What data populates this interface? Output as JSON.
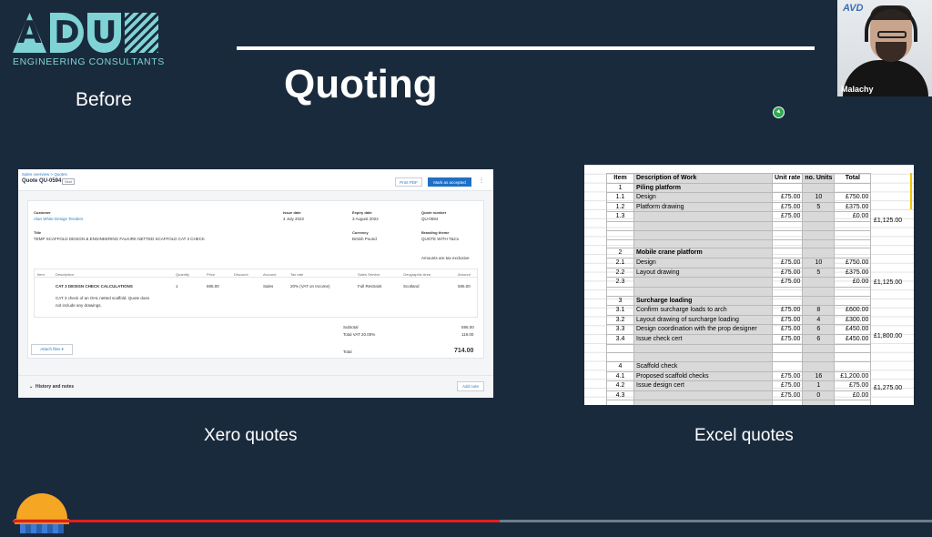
{
  "logo": {
    "letters": [
      "A",
      "D",
      "U",
      "N"
    ],
    "subtitle": "ENGINEERING CONSULTANTS"
  },
  "slide": {
    "title": "Quoting",
    "before_label": "Before",
    "xero_caption": "Xero quotes",
    "excel_caption": "Excel quotes"
  },
  "webcam": {
    "name": "Malachy",
    "logo": "AVD"
  },
  "xero": {
    "breadcrumb": "Sales overview  >  Quotes",
    "quote_id": "Quote QU-0594",
    "badge": "Sent",
    "print_pdf": "Print PDF",
    "mark_accepted": "Mark as accepted",
    "more": "⋮",
    "labels": {
      "customer": "Customer",
      "issue_date": "Issue date",
      "expiry_date": "Expiry date",
      "quote_number": "Quote number",
      "title": "Title",
      "currency": "Currency",
      "branding": "Branding theme"
    },
    "values": {
      "customer": "Alan White Design Tenders",
      "issue_date": "4 July 2022",
      "expiry_date": "3 August 2022",
      "quote_number": "QU-0594",
      "title": "TEMP SCAFFOLD DESIGN & ENGINEERING FALKIRK NETTED SCAFFOLD CAT 3 CHECK",
      "currency": "British Pound",
      "branding": "QUOTE WITH T&Cs"
    },
    "tax_note": "Amounts are tax exclusive",
    "columns": [
      "Item",
      "Description",
      "Quantity",
      "Price",
      "Discount",
      "Account",
      "Tax rate",
      "Sales Service",
      "Geographic Area",
      "Amount"
    ],
    "line": {
      "description": "CAT 3 DESIGN CHECK CALCULATIONS",
      "quantity": "1",
      "price": "595.00",
      "account": "Sales",
      "tax_rate": "20% (VAT on Income)",
      "service": "Full Restraint",
      "area": "Scotland",
      "amount": "595.00",
      "note1": "CAT 3 check of an OHL netted scaffold. Quote does",
      "note2": "not include any drawings."
    },
    "totals": {
      "subtotal_label": "Subtotal",
      "subtotal": "595.00",
      "vat_label": "Total VAT 20.00%",
      "vat": "119.00",
      "total_label": "Total",
      "total": "714.00"
    },
    "attach_files": "Attach files  ▾",
    "history": "History and notes",
    "add_note": "Add note"
  },
  "excel": {
    "headers": [
      "Item",
      "Description of Work",
      "Unit rate",
      "no. Units",
      "Total"
    ],
    "rows": [
      [
        "1",
        "Piling platform",
        "",
        "",
        "",
        "bold"
      ],
      [
        "1.1",
        "Design",
        "£75.00",
        "10",
        "£750.00",
        ""
      ],
      [
        "1.2",
        "Platform drawing",
        "£75.00",
        "5",
        "£375.00",
        ""
      ],
      [
        "1.3",
        "",
        "£75.00",
        "",
        "£0.00",
        ""
      ],
      [
        "",
        "",
        "",
        "",
        "",
        ""
      ],
      [
        "",
        "",
        "",
        "",
        "",
        ""
      ],
      [
        "",
        "",
        "",
        "",
        "",
        ""
      ],
      [
        "2",
        "Mobile crane platform",
        "",
        "",
        "",
        "bold"
      ],
      [
        "2.1",
        "Design",
        "£75.00",
        "10",
        "£750.00",
        ""
      ],
      [
        "2.2",
        "Layout drawing",
        "£75.00",
        "5",
        "£375.00",
        ""
      ],
      [
        "2.3",
        "",
        "£75.00",
        "",
        "£0.00",
        ""
      ],
      [
        "",
        "",
        "",
        "",
        "",
        ""
      ],
      [
        "3",
        "Surcharge loading",
        "",
        "",
        "",
        "bold"
      ],
      [
        "3.1",
        "Confirm surcharge loads to arch",
        "£75.00",
        "8",
        "£600.00",
        ""
      ],
      [
        "3.2",
        "Layout drawing of surcharge loading",
        "£75.00",
        "4",
        "£300.00",
        ""
      ],
      [
        "3.3",
        "Design coordination with the prop designer",
        "£75.00",
        "6",
        "£450.00",
        ""
      ],
      [
        "3.4",
        "Issue check cert",
        "£75.00",
        "6",
        "£450.00",
        ""
      ],
      [
        "",
        "",
        "",
        "",
        "",
        ""
      ],
      [
        "",
        "",
        "",
        "",
        "",
        ""
      ],
      [
        "4",
        "Scaffold check",
        "",
        "",
        "",
        ""
      ],
      [
        "4.1",
        "Proposed scaffold checks",
        "£75.00",
        "16",
        "£1,200.00",
        ""
      ],
      [
        "4.2",
        "Issue design cert",
        "£75.00",
        "1",
        "£75.00",
        ""
      ],
      [
        "4.3",
        "",
        "£75.00",
        "0",
        "£0.00",
        ""
      ],
      [
        "",
        "",
        "",
        "",
        "",
        ""
      ],
      [
        "",
        "",
        "",
        "",
        "",
        ""
      ]
    ],
    "section_totals": [
      "£1,125.00",
      "£1,125.00",
      "£1,800.00",
      "£1,275.00"
    ]
  },
  "video": {
    "played_fraction": 0.53,
    "buffered_fraction": 0.29
  },
  "colors": {
    "background": "#1a2a3d",
    "accent_teal": "#7fd3d4",
    "progress_red": "#e02020"
  }
}
